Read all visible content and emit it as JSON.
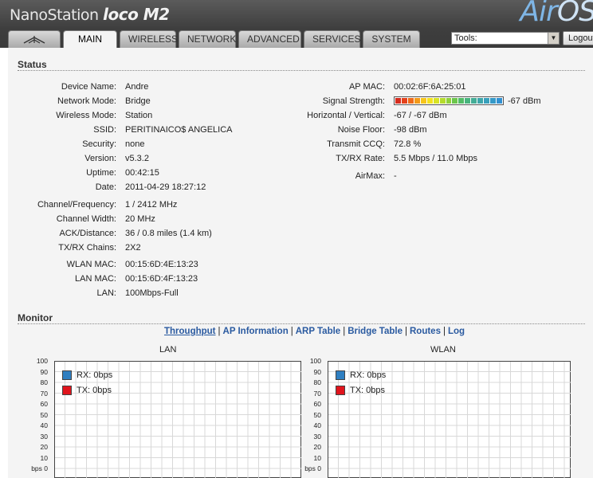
{
  "header": {
    "brand": "NanoStation",
    "brand_model": "loco M2",
    "airos_air": "Air",
    "airos_os": "OS"
  },
  "tabs": [
    "MAIN",
    "WIRELESS",
    "NETWORK",
    "ADVANCED",
    "SERVICES",
    "SYSTEM"
  ],
  "active_tab": "MAIN",
  "tools": {
    "selected": "Tools:"
  },
  "logout_label": "Logout",
  "status": {
    "title": "Status",
    "left": [
      {
        "label": "Device Name:",
        "value": "Andre"
      },
      {
        "label": "Network Mode:",
        "value": "Bridge"
      },
      {
        "label": "Wireless Mode:",
        "value": "Station"
      },
      {
        "label": "SSID:",
        "value": "PERITINAICO$ ANGELICA"
      },
      {
        "label": "Security:",
        "value": "none"
      },
      {
        "label": "Version:",
        "value": "v5.3.2"
      },
      {
        "label": "Uptime:",
        "value": "00:42:15"
      },
      {
        "label": "Date:",
        "value": "2011-04-29 18:27:12"
      },
      {
        "label": "Channel/Frequency:",
        "value": "1 / 2412 MHz"
      },
      {
        "label": "Channel Width:",
        "value": "20 MHz"
      },
      {
        "label": "ACK/Distance:",
        "value": "36 / 0.8 miles (1.4 km)"
      },
      {
        "label": "TX/RX Chains:",
        "value": "2X2"
      },
      {
        "label": "WLAN MAC:",
        "value": "00:15:6D:4E:13:23"
      },
      {
        "label": "LAN MAC:",
        "value": "00:15:6D:4F:13:23"
      },
      {
        "label": "LAN:",
        "value": "100Mbps-Full"
      }
    ],
    "right": [
      {
        "label": "AP MAC:",
        "value": "00:02:6F:6A:25:01"
      },
      {
        "label": "Signal Strength:",
        "value": "-67 dBm"
      },
      {
        "label": "Horizontal / Vertical:",
        "value": "-67 / -67 dBm"
      },
      {
        "label": "Noise Floor:",
        "value": "-98 dBm"
      },
      {
        "label": "Transmit CCQ:",
        "value": "72.8 %"
      },
      {
        "label": "TX/RX Rate:",
        "value": "5.5 Mbps / 11.0 Mbps"
      },
      {
        "label": "AirMax:",
        "value": "-"
      }
    ],
    "signal_colors": [
      "#d62c1e",
      "#e4421c",
      "#ee6a1a",
      "#f49a18",
      "#f7c51a",
      "#f4e21e",
      "#d8e424",
      "#b5dc2c",
      "#8fd13a",
      "#6cc64c",
      "#52bc66",
      "#48b47e",
      "#43ad96",
      "#3ea6aa",
      "#39a0bc",
      "#3599c8",
      "#3191d2"
    ]
  },
  "monitor": {
    "title": "Monitor",
    "links": [
      "Throughput",
      "AP Information",
      "ARP Table",
      "Bridge Table",
      "Routes",
      "Log"
    ],
    "active_link": "Throughput",
    "separator": "|"
  },
  "chart_data": [
    {
      "type": "line",
      "title": "LAN",
      "yticks": [
        "100",
        "90",
        "80",
        "70",
        "60",
        "50",
        "40",
        "30",
        "20",
        "10",
        "bps 0"
      ],
      "ylim": [
        0,
        100
      ],
      "grid": true,
      "legend_position": "top-left",
      "series": [
        {
          "name": "RX: 0bps",
          "color": "#2f7fc1",
          "values": []
        },
        {
          "name": "TX: 0bps",
          "color": "#e0141c",
          "values": []
        }
      ]
    },
    {
      "type": "line",
      "title": "WLAN",
      "yticks": [
        "100",
        "90",
        "80",
        "70",
        "60",
        "50",
        "40",
        "30",
        "20",
        "10",
        "bps 0"
      ],
      "ylim": [
        0,
        100
      ],
      "grid": true,
      "legend_position": "top-left",
      "series": [
        {
          "name": "RX: 0bps",
          "color": "#2f7fc1",
          "values": []
        },
        {
          "name": "TX: 0bps",
          "color": "#e0141c",
          "values": []
        }
      ]
    }
  ]
}
